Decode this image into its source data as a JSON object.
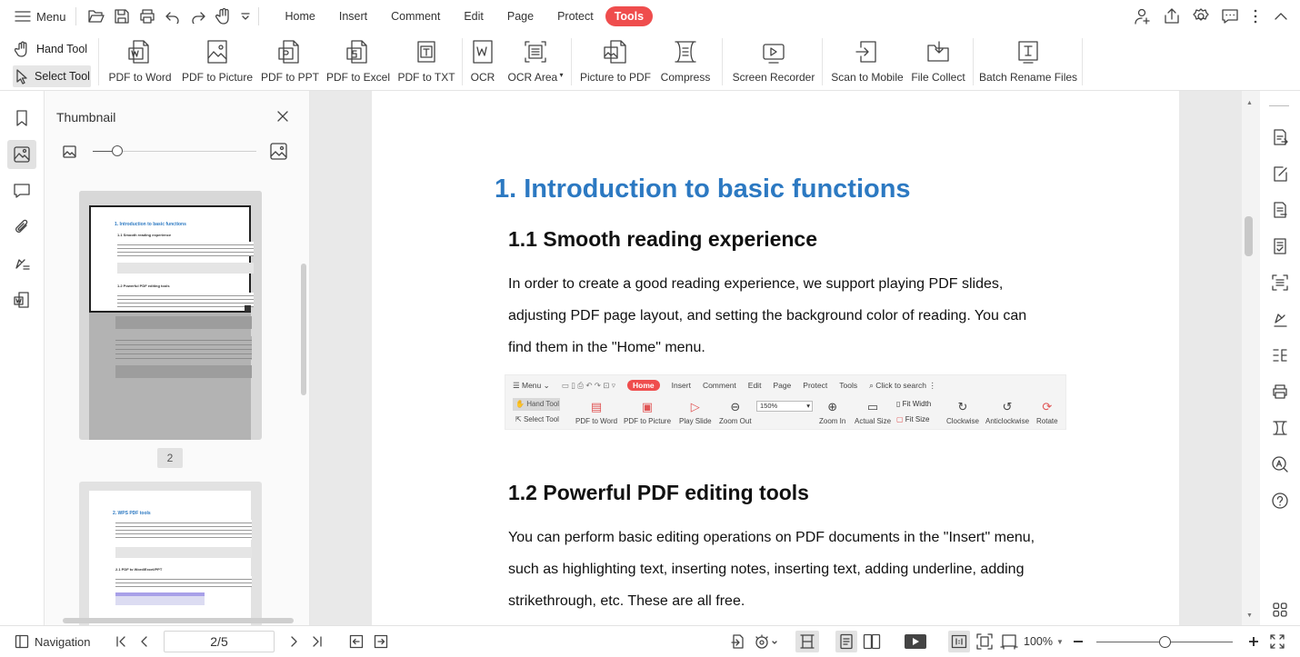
{
  "menubar": {
    "menu_label": "Menu",
    "tabs": [
      {
        "label": "Home"
      },
      {
        "label": "Insert"
      },
      {
        "label": "Comment"
      },
      {
        "label": "Edit"
      },
      {
        "label": "Page"
      },
      {
        "label": "Protect"
      },
      {
        "label": "Tools"
      }
    ],
    "active_tab": "Tools",
    "accent_color": "#ef4d4d"
  },
  "ribbon": {
    "hand_tool": "Hand Tool",
    "select_tool": "Select Tool",
    "buttons": [
      {
        "label": "PDF to Word",
        "icon": "pdf-to-word-icon"
      },
      {
        "label": "PDF to Picture",
        "icon": "pdf-to-picture-icon"
      },
      {
        "label": "PDF to PPT",
        "icon": "pdf-to-ppt-icon"
      },
      {
        "label": "PDF to Excel",
        "icon": "pdf-to-excel-icon"
      },
      {
        "label": "PDF to TXT",
        "icon": "pdf-to-txt-icon"
      },
      {
        "label": "OCR",
        "icon": "ocr-icon"
      },
      {
        "label": "OCR Area",
        "icon": "ocr-area-icon"
      },
      {
        "label": "Picture to PDF",
        "icon": "picture-to-pdf-icon"
      },
      {
        "label": "Compress",
        "icon": "compress-icon"
      },
      {
        "label": "Screen Recorder",
        "icon": "screen-recorder-icon"
      },
      {
        "label": "Scan to Mobile",
        "icon": "scan-to-mobile-icon"
      },
      {
        "label": "File Collect",
        "icon": "file-collect-icon"
      },
      {
        "label": "Batch Rename Files",
        "icon": "batch-rename-icon"
      }
    ]
  },
  "thumbnail_panel": {
    "title": "Thumbnail",
    "current_page_label": "2",
    "zoom_level": 0.15,
    "thumb1": {
      "h1": "1. Introduction to basic functions",
      "h2a": "1.1 Smooth reading experience",
      "h2b": "1.2 Powerful PDF editing tools"
    },
    "thumb2": {
      "h1": "2.  WPS PDF tools",
      "h2": "2.1 PDF to Word/Excel/PPT"
    }
  },
  "document": {
    "h1": "1. Introduction to basic functions",
    "s1_title": "1.1 Smooth reading experience",
    "s1_lines": [
      "In order to create a good reading experience, we support playing PDF slides,",
      "adjusting PDF page layout, and setting the background color of reading. You can",
      "find them in the \"Home\" menu."
    ],
    "s2_title": "1.2 Powerful PDF editing tools",
    "s2_lines": [
      "You can perform basic editing operations on PDF documents in the \"Insert\" menu,",
      "such as highlighting text, inserting notes, inserting text, adding underline, adding",
      "strikethrough, etc. These are all free."
    ],
    "embedded_toolbar": {
      "menu": "Menu",
      "tabs": [
        "Home",
        "Insert",
        "Comment",
        "Edit",
        "Page",
        "Protect",
        "Tools"
      ],
      "search": "Click to search",
      "hand_tool": "Hand Tool",
      "select_tool": "Select Tool",
      "buttons": [
        "PDF to Word",
        "PDF to Picture",
        "Play Slide",
        "Zoom Out",
        "Zoom In",
        "Actual Size",
        "Clockwise",
        "Anticlockwise",
        "Rotate"
      ],
      "zoom_value": "150%",
      "fit_width": "Fit Width",
      "fit_size": "Fit Size"
    }
  },
  "statusbar": {
    "navigation": "Navigation",
    "page_indicator": "2/5",
    "zoom": "100%",
    "zoom_slider_level": 0.5
  }
}
